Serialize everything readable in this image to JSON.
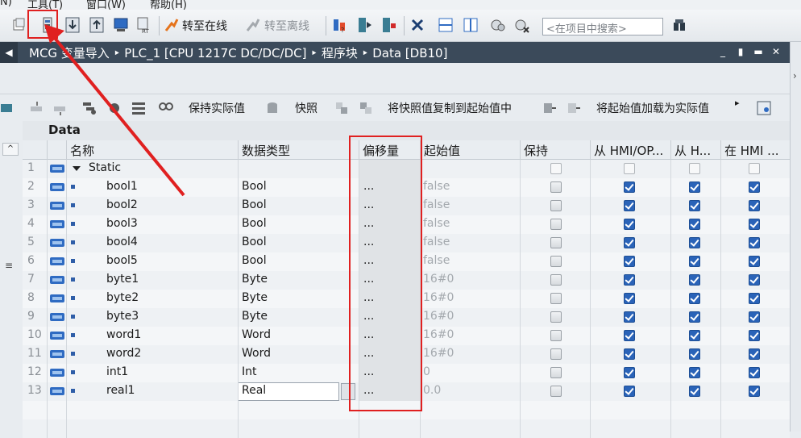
{
  "menu": {
    "items": [
      "N)",
      "工具(T)",
      "窗口(W)",
      "帮助(H)"
    ]
  },
  "toolbar": {
    "go_online_label": "转至在线",
    "go_offline_label": "转至离线",
    "search_placeholder": "<在项目中搜索>"
  },
  "titlebar": {
    "path": "MCG 变量导入 ‣ PLC_1 [CPU 1217C DC/DC/DC] ‣ 程序块 ‣ Data [DB10]",
    "min": "_",
    "restore": "▮",
    "max": "▬",
    "close": "✕"
  },
  "toolbar2": {
    "keep_actual_label": "保持实际值",
    "snapshot_label": "快照",
    "copy_snapshot_label": "将快照值复制到起始值中",
    "load_start_label": "将起始值加载为实际值"
  },
  "data_header": "Data",
  "table": {
    "columns": [
      "名称",
      "数据类型",
      "偏移量",
      "起始值",
      "保持",
      "从 HMI/OP...",
      "从 H...",
      "在 HMI ..."
    ],
    "rows": [
      {
        "num": "1",
        "name": "Static",
        "type": "",
        "offset": "",
        "start": "",
        "retain": "empty",
        "hmi1": "empty",
        "hmi2": "empty",
        "hmi3": "empty",
        "group": true
      },
      {
        "num": "2",
        "name": "bool1",
        "type": "Bool",
        "offset": "...",
        "start": "false",
        "retain": "gray",
        "hmi1": "on",
        "hmi2": "on",
        "hmi3": "on"
      },
      {
        "num": "3",
        "name": "bool2",
        "type": "Bool",
        "offset": "...",
        "start": "false",
        "retain": "gray",
        "hmi1": "on",
        "hmi2": "on",
        "hmi3": "on"
      },
      {
        "num": "4",
        "name": "bool3",
        "type": "Bool",
        "offset": "...",
        "start": "false",
        "retain": "gray",
        "hmi1": "on",
        "hmi2": "on",
        "hmi3": "on"
      },
      {
        "num": "5",
        "name": "bool4",
        "type": "Bool",
        "offset": "...",
        "start": "false",
        "retain": "gray",
        "hmi1": "on",
        "hmi2": "on",
        "hmi3": "on"
      },
      {
        "num": "6",
        "name": "bool5",
        "type": "Bool",
        "offset": "...",
        "start": "false",
        "retain": "gray",
        "hmi1": "on",
        "hmi2": "on",
        "hmi3": "on"
      },
      {
        "num": "7",
        "name": "byte1",
        "type": "Byte",
        "offset": "...",
        "start": "16#0",
        "retain": "gray",
        "hmi1": "on",
        "hmi2": "on",
        "hmi3": "on"
      },
      {
        "num": "8",
        "name": "byte2",
        "type": "Byte",
        "offset": "...",
        "start": "16#0",
        "retain": "gray",
        "hmi1": "on",
        "hmi2": "on",
        "hmi3": "on"
      },
      {
        "num": "9",
        "name": "byte3",
        "type": "Byte",
        "offset": "...",
        "start": "16#0",
        "retain": "gray",
        "hmi1": "on",
        "hmi2": "on",
        "hmi3": "on"
      },
      {
        "num": "10",
        "name": "word1",
        "type": "Word",
        "offset": "...",
        "start": "16#0",
        "retain": "gray",
        "hmi1": "on",
        "hmi2": "on",
        "hmi3": "on"
      },
      {
        "num": "11",
        "name": "word2",
        "type": "Word",
        "offset": "...",
        "start": "16#0",
        "retain": "gray",
        "hmi1": "on",
        "hmi2": "on",
        "hmi3": "on"
      },
      {
        "num": "12",
        "name": "int1",
        "type": "Int",
        "offset": "...",
        "start": "0",
        "retain": "gray",
        "hmi1": "on",
        "hmi2": "on",
        "hmi3": "on"
      },
      {
        "num": "13",
        "name": "real1",
        "type": "Real",
        "offset": "...",
        "start": "0.0",
        "retain": "gray",
        "hmi1": "on",
        "hmi2": "on",
        "hmi3": "on",
        "editing": true
      }
    ]
  },
  "colors": {
    "accent": "#2a63b8",
    "annotation": "#e02020",
    "titlebar": "#3b4a5a"
  }
}
